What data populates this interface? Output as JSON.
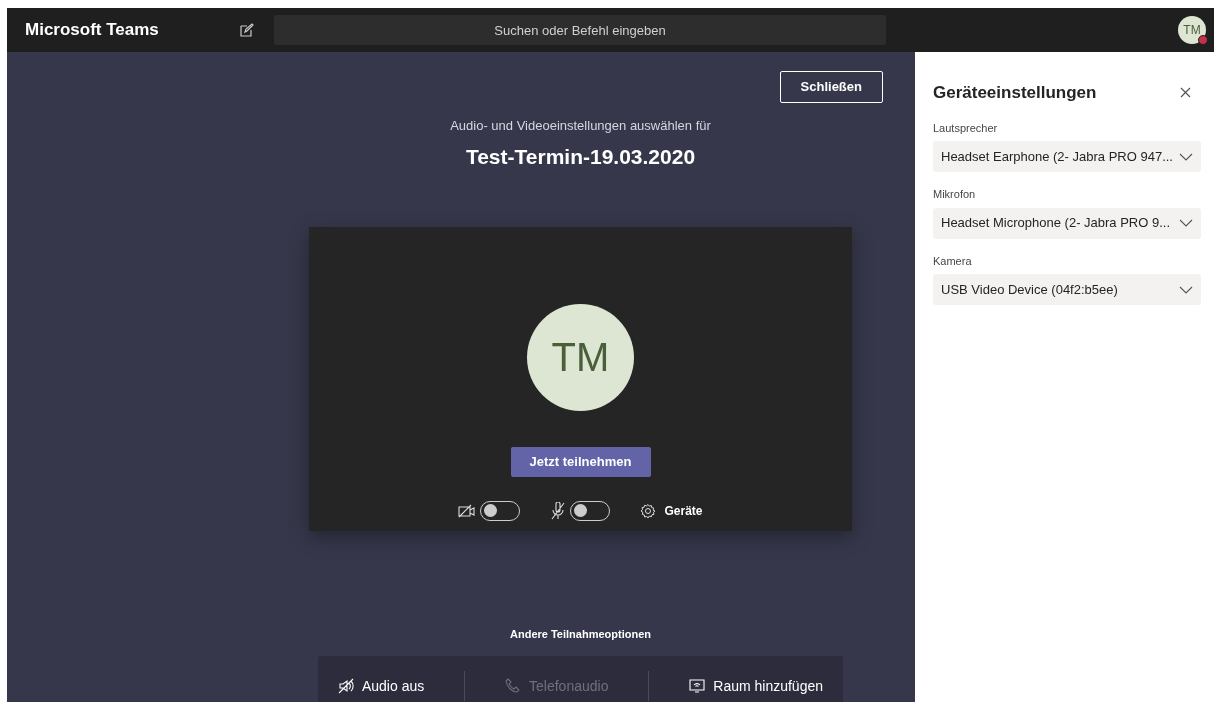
{
  "app_bar": {
    "title": "Microsoft Teams",
    "search": {
      "placeholder": "Suchen oder Befehl eingeben"
    },
    "avatar": {
      "initials": "TM",
      "busy": true
    }
  },
  "close_button": "Schließen",
  "subtitle": "Audio- und Videoeinstellungen auswählen für",
  "meeting_title": "Test-Termin-19.03.2020",
  "preview": {
    "initials": "TM",
    "join_button": "Jetzt teilnehmen",
    "toggles": [
      {
        "kind": "camera",
        "on": false
      },
      {
        "kind": "microphone",
        "on": false
      }
    ],
    "devices_button": "Geräte"
  },
  "other_options": {
    "heading": "Andere Teilnahmeoptionen",
    "items": [
      {
        "kind": "audio-off",
        "label": "Audio aus",
        "disabled": false
      },
      {
        "kind": "phone",
        "label": "Telefonaudio",
        "disabled": true
      },
      {
        "kind": "room",
        "label": "Raum hinzufügen",
        "disabled": false
      }
    ]
  },
  "device_settings": {
    "title": "Geräteeinstellungen",
    "fields": [
      {
        "label": "Lautsprecher",
        "value": "Headset Earphone (2- Jabra PRO 947..."
      },
      {
        "label": "Mikrofon",
        "value": "Headset Microphone (2- Jabra PRO 9..."
      },
      {
        "label": "Kamera",
        "value": "USB Video Device (04f2:b5ee)"
      }
    ]
  }
}
